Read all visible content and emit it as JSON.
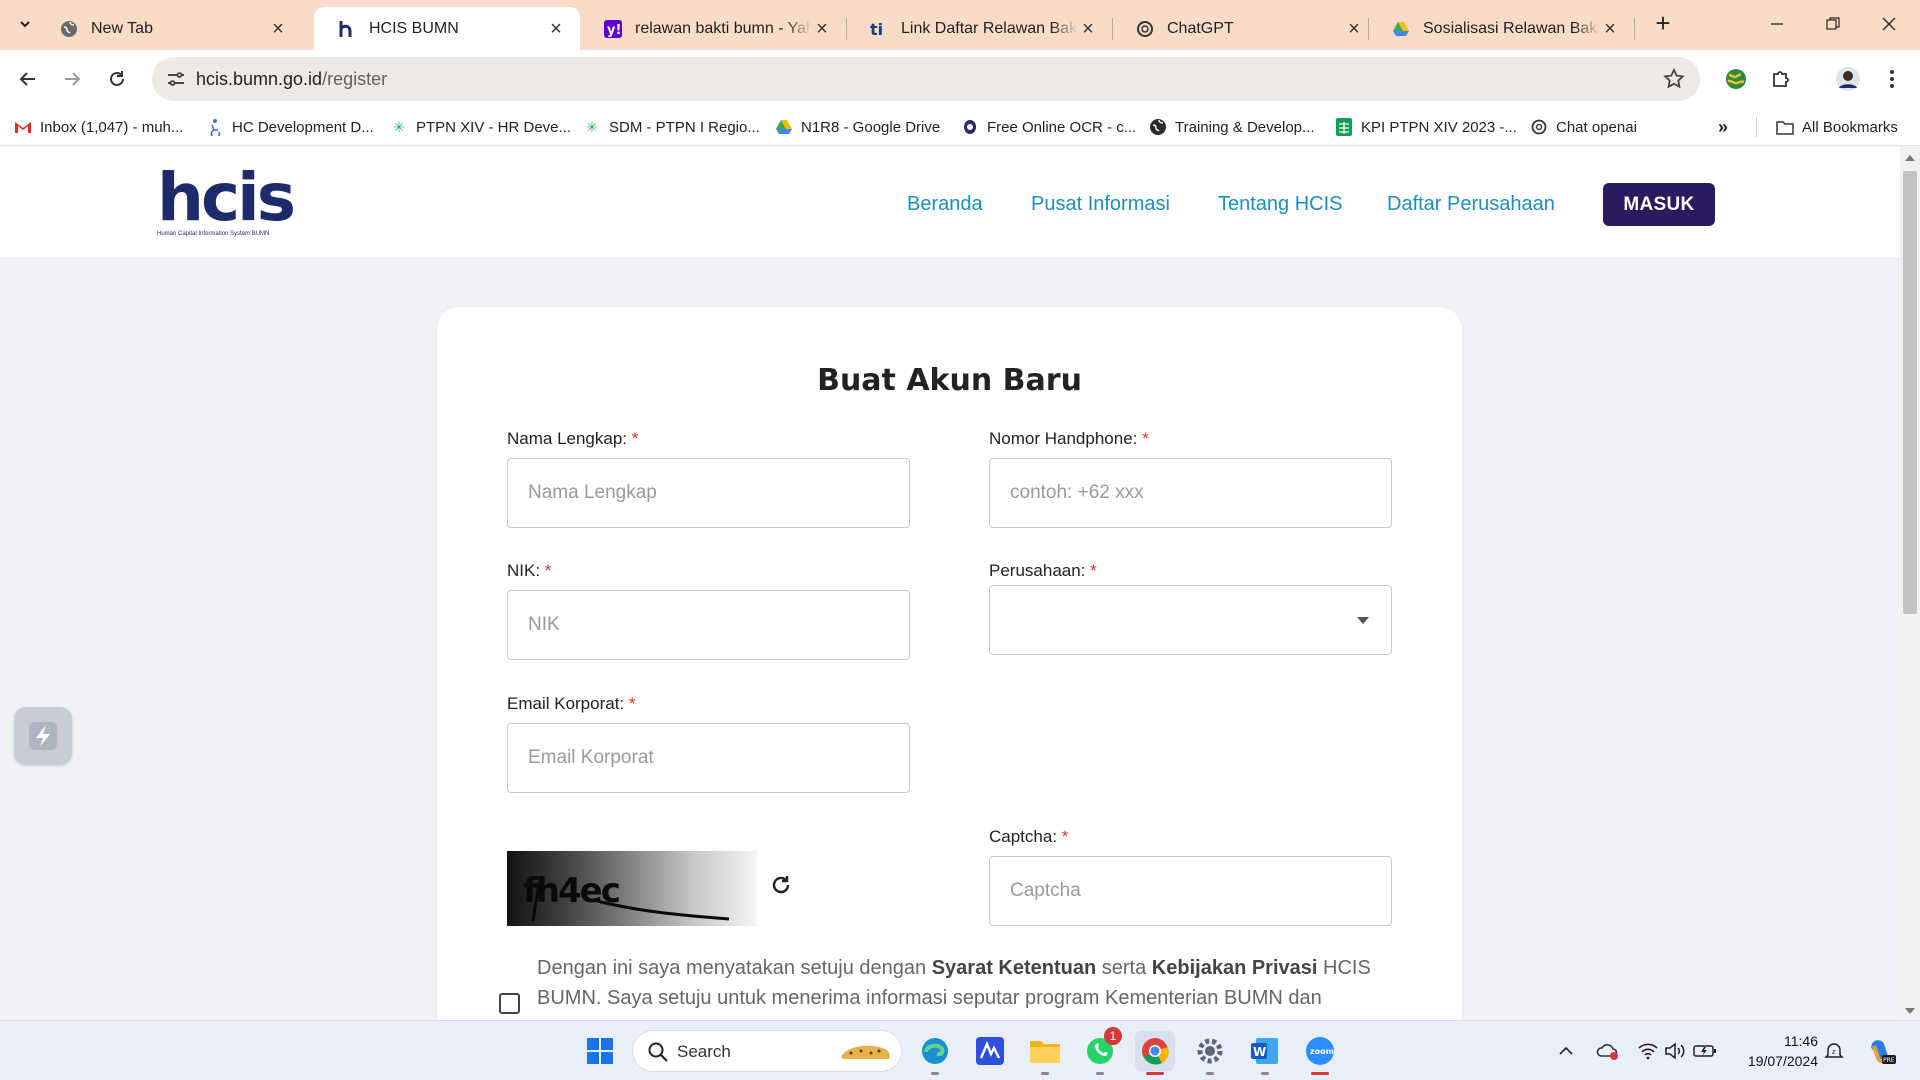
{
  "browser": {
    "tabs": [
      {
        "title": "New Tab",
        "active": false
      },
      {
        "title": "HCIS BUMN",
        "active": true
      },
      {
        "title": "relawan bakti bumn - Yahoo",
        "active": false
      },
      {
        "title": "Link Daftar Relawan Bakti BUMN",
        "active": false
      },
      {
        "title": "ChatGPT",
        "active": false
      },
      {
        "title": "Sosialisasi Relawan Bakti BUMN",
        "active": false
      }
    ],
    "url_host": "hcis.bumn.go.id",
    "url_path": "/register",
    "bookmarks": [
      "Inbox (1,047) - muh...",
      "HC Development D...",
      "PTPN XIV - HR Deve...",
      "SDM - PTPN I Regio...",
      "N1R8 - Google Drive",
      "Free Online OCR - c...",
      "Training & Develop...",
      "KPI PTPN XIV 2023 -...",
      "Chat openai"
    ],
    "all_bookmarks": "All Bookmarks"
  },
  "site": {
    "logo_text": "hcis",
    "logo_tagline": "Human Capital Information System BUMN",
    "nav": [
      "Beranda",
      "Pusat Informasi",
      "Tentang HCIS",
      "Daftar Perusahaan"
    ],
    "login_button": "MASUK"
  },
  "form": {
    "title": "Buat Akun Baru",
    "required_mark": "*",
    "fields": {
      "nama": {
        "label": "Nama Lengkap:",
        "placeholder": "Nama Lengkap",
        "value": ""
      },
      "phone": {
        "label": "Nomor Handphone:",
        "placeholder": "contoh: +62 xxx",
        "value": ""
      },
      "nik": {
        "label": "NIK:",
        "placeholder": "NIK",
        "value": ""
      },
      "perusahaan": {
        "label": "Perusahaan:",
        "selected": ""
      },
      "email": {
        "label": "Email Korporat:",
        "placeholder": "Email Korporat",
        "value": ""
      },
      "captcha": {
        "label": "Captcha:",
        "placeholder": "Captcha",
        "value": ""
      }
    },
    "captcha_image_text": "fh4ec",
    "agreement": {
      "part1": "Dengan ini saya menyatakan setuju dengan ",
      "terms": "Syarat Ketentuan",
      "part2": " serta ",
      "privacy": "Kebijakan Privasi",
      "part3": " HCIS BUMN. Saya setuju untuk menerima informasi seputar program Kementerian BUMN dan",
      "checked": false
    }
  },
  "taskbar": {
    "search_label": "Search",
    "whatsapp_badge": "1",
    "time": "11:46",
    "date": "19/07/2024"
  },
  "colors": {
    "nav_link": "#1b8ec0",
    "login_bg": "#2a1a5e",
    "required": "#e23232",
    "tabstrip": "#f9dcc8"
  }
}
